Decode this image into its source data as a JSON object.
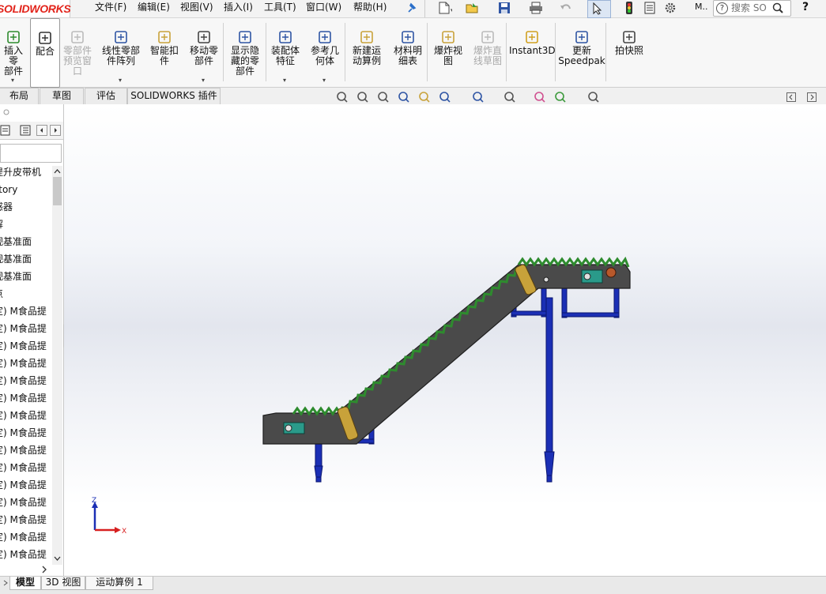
{
  "app": {
    "logo_text": "SOLIDWORKS"
  },
  "menu": [
    "文件(F)",
    "编辑(E)",
    "视图(V)",
    "插入(I)",
    "工具(T)",
    "窗口(W)",
    "帮助(H)"
  ],
  "quick_access": {
    "icons": [
      "pin-icon",
      "new-document-icon",
      "open-icon",
      "save-icon",
      "print-icon",
      "undo-icon",
      "select-arrow-icon",
      "rebuild-traffic-light-icon",
      "file-properties-icon",
      "options-gear-icon"
    ],
    "extra_label": "M..",
    "search_placeholder": "搜索 SO",
    "help_label": "?"
  },
  "ribbon": [
    {
      "id": "insert-part",
      "label": "插入零\n部件",
      "icon": "insert-component-icon",
      "disabled": false,
      "dropdown": true,
      "active": false
    },
    {
      "id": "mate",
      "label": "配合",
      "icon": "mate-paperclip-icon",
      "disabled": false,
      "dropdown": false,
      "active": true
    },
    {
      "id": "component-preview",
      "label": "零部件\n预览窗\n口",
      "icon": "component-preview-icon",
      "disabled": true,
      "dropdown": false,
      "active": false
    },
    {
      "id": "linear-pattern",
      "label": "线性零部\n件阵列",
      "icon": "linear-pattern-icon",
      "disabled": false,
      "dropdown": true,
      "active": false
    },
    {
      "id": "smart-fasteners",
      "label": "智能扣\n件",
      "icon": "smart-fastener-icon",
      "disabled": false,
      "dropdown": false,
      "active": false
    },
    {
      "id": "move-component",
      "label": "移动零\n部件",
      "icon": "move-component-icon",
      "disabled": false,
      "dropdown": true,
      "active": false
    },
    {
      "id": "show-hidden",
      "label": "显示隐\n藏的零\n部件",
      "icon": "show-hidden-icon",
      "disabled": false,
      "dropdown": false,
      "active": false
    },
    {
      "id": "assembly-features",
      "label": "装配体\n特征",
      "icon": "assembly-feature-icon",
      "disabled": false,
      "dropdown": true,
      "active": false
    },
    {
      "id": "reference-geometry",
      "label": "参考几\n何体",
      "icon": "reference-geometry-icon",
      "disabled": false,
      "dropdown": true,
      "active": false
    },
    {
      "id": "new-motion-study",
      "label": "新建运\n动算例",
      "icon": "motion-study-icon",
      "disabled": false,
      "dropdown": false,
      "active": false
    },
    {
      "id": "bom",
      "label": "材料明\n细表",
      "icon": "bill-of-materials-icon",
      "disabled": false,
      "dropdown": false,
      "active": false
    },
    {
      "id": "exploded-view",
      "label": "爆炸视\n图",
      "icon": "exploded-view-icon",
      "disabled": false,
      "dropdown": false,
      "active": false
    },
    {
      "id": "explode-line-sketch",
      "label": "爆炸直\n线草图",
      "icon": "explode-line-icon",
      "disabled": true,
      "dropdown": false,
      "active": false
    },
    {
      "id": "instant3d",
      "label": "Instant3D",
      "icon": "instant3d-icon",
      "disabled": false,
      "dropdown": false,
      "active": false
    },
    {
      "id": "speedpak",
      "label": "更新\nSpeedpak",
      "icon": "speedpak-icon",
      "disabled": false,
      "dropdown": false,
      "active": false
    },
    {
      "id": "snapshot",
      "label": "拍快照",
      "icon": "camera-icon",
      "disabled": false,
      "dropdown": false,
      "active": false
    }
  ],
  "command_tabs": [
    "布局",
    "草图",
    "评估",
    "SOLIDWORKS 插件"
  ],
  "heads_up_icons": [
    "zoom-to-fit-icon",
    "zoom-to-area-icon",
    "previous-view-icon",
    "section-view-icon",
    "dynamic-annotation-icon",
    "view-orientation-icon",
    "display-style-icon",
    "hide-show-items-icon",
    "edit-appearance-icon",
    "apply-scene-icon",
    "view-settings-icon"
  ],
  "feature_tree": {
    "items": [
      "提升皮带机",
      "story",
      "感器",
      "解",
      "视基准面",
      "视基准面",
      "视基准面",
      "点",
      "定) M食品提",
      "定) M食品提",
      "定) M食品提",
      "定) M食品提",
      "定) M食品提",
      "定) M食品提",
      "定) M食品提",
      "定) M食品提",
      "定) M食品提",
      "定) M食品提",
      "定) M食品提",
      "定) M食品提",
      "定) M食品提",
      "定) M食品提",
      "定) M食品提"
    ]
  },
  "triad": {
    "z_label": "Z",
    "x_label": "X"
  },
  "bottom_tabs": [
    "模型",
    "3D 视图",
    "运动算例 1"
  ],
  "colors": {
    "frame_blue": "#1b2fb5",
    "belt_cleat_green": "#2e8b2e",
    "belt_gray": "#4a4a4a"
  }
}
